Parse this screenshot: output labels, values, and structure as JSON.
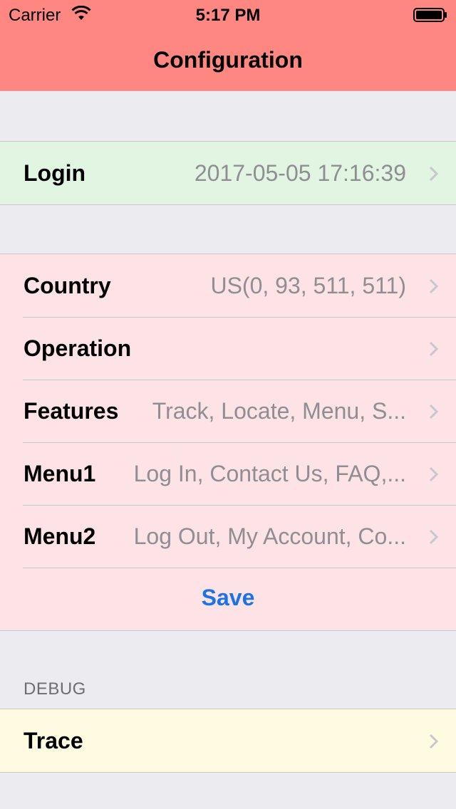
{
  "status_bar": {
    "carrier": "Carrier",
    "time": "5:17 PM"
  },
  "navbar": {
    "title": "Configuration"
  },
  "login_row": {
    "label": "Login",
    "detail": "2017-05-05 17:16:39"
  },
  "settings": [
    {
      "label": "Country",
      "detail": "US(0, 93, 511, 511)"
    },
    {
      "label": "Operation",
      "detail": ""
    },
    {
      "label": "Features",
      "detail": "Track, Locate, Menu, S..."
    },
    {
      "label": "Menu1",
      "detail": "Log In, Contact Us, FAQ,..."
    },
    {
      "label": "Menu2",
      "detail": "Log Out, My Account, Co..."
    }
  ],
  "save_label": "Save",
  "debug": {
    "header": "DEBUG",
    "trace_label": "Trace"
  },
  "colors": {
    "navbar": "#ff8782",
    "login_bg": "#e2f4e2",
    "settings_bg": "#fee3e6",
    "trace_bg": "#fefbe0",
    "accent": "#1a73e8"
  },
  "icons": {
    "wifi": "wifi-icon",
    "battery": "battery-icon",
    "chevron": "chevron-right-icon"
  }
}
